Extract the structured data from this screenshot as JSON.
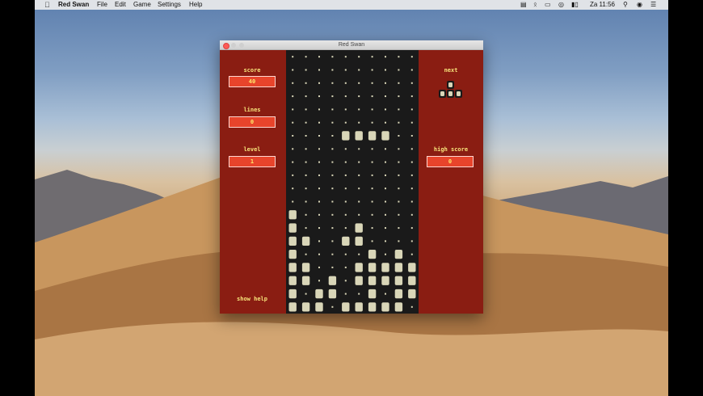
{
  "menubar": {
    "app_name": "Red Swan",
    "menus": [
      "File",
      "Edit",
      "Game",
      "Settings",
      "Help"
    ],
    "clock": "Za 11:56"
  },
  "window": {
    "title": "Red Swan",
    "score_label": "score",
    "score_value": "40",
    "lines_label": "lines",
    "lines_value": "0",
    "level_label": "level",
    "level_value": "1",
    "next_label": "next",
    "high_score_label": "high score",
    "high_score_value": "0",
    "help_label": "show help"
  },
  "colors": {
    "panel": "#8a1d12",
    "board": "#1a1a1a",
    "block": "#d9d6b8",
    "value_box": "#e8442b",
    "label_text": "#f7e37a"
  },
  "board": {
    "cols": 10,
    "rows": 20,
    "cells": [
      "..........",
      "..........",
      "..........",
      "..........",
      "..........",
      "..........",
      "....####..",
      "..........",
      "..........",
      "..........",
      "..........",
      "..........",
      "#.........",
      "#....#....",
      "##..##....",
      "#.....#.#.",
      "##...#####",
      "##.#.#####",
      "#.##..#.##",
      "###.#####."
    ]
  },
  "next_piece": {
    "cells": [
      ".#.",
      "###"
    ]
  }
}
